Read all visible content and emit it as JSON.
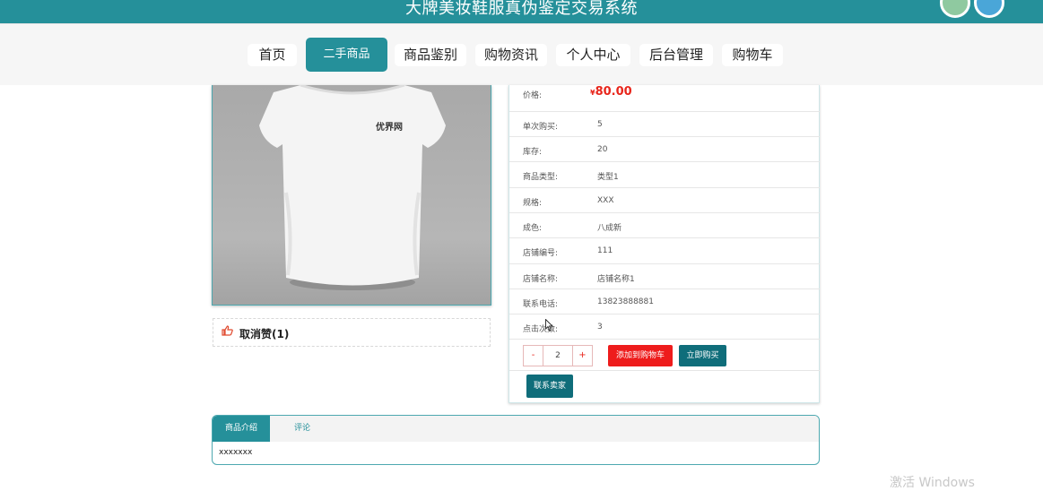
{
  "header": {
    "site_title": "大牌美妆鞋服真伪鉴定交易系统",
    "colors": {
      "primary": "#25909a",
      "dark": "#0f6d7a",
      "danger": "#ee1c1c"
    }
  },
  "nav": {
    "items": [
      {
        "label": "首页"
      },
      {
        "label": "二手商品",
        "active": true
      },
      {
        "label": "商品鉴别"
      },
      {
        "label": "购物资讯"
      },
      {
        "label": "个人中心"
      },
      {
        "label": "后台管理"
      },
      {
        "label": "购物车"
      }
    ]
  },
  "product": {
    "image_logo_text": "优界网",
    "like_label": "取消赞(1)",
    "price_label": "价格:",
    "price_currency": "¥",
    "price_value": "80.00",
    "fields": [
      {
        "label": "单次购买:",
        "value": "5"
      },
      {
        "label": "库存:",
        "value": "20"
      },
      {
        "label": "商品类型:",
        "value": "类型1"
      },
      {
        "label": "规格:",
        "value": "XXX"
      },
      {
        "label": "成色:",
        "value": "八成新"
      },
      {
        "label": "店铺编号:",
        "value": "111"
      },
      {
        "label": "店铺名称:",
        "value": "店铺名称1"
      },
      {
        "label": "联系电话:",
        "value": "13823888881"
      },
      {
        "label": "点击次数:",
        "value": "3"
      }
    ],
    "quantity": {
      "minus": "-",
      "value": "2",
      "plus": "+"
    },
    "add_to_cart_label": "添加到购物车",
    "buy_now_label": "立即购买",
    "contact_seller_label": "联系卖家"
  },
  "tabs": {
    "items": [
      {
        "label": "商品介绍",
        "active": true
      },
      {
        "label": "评论"
      }
    ],
    "content": "xxxxxxx"
  },
  "overlay": {
    "watermark": "激活 Windows"
  }
}
